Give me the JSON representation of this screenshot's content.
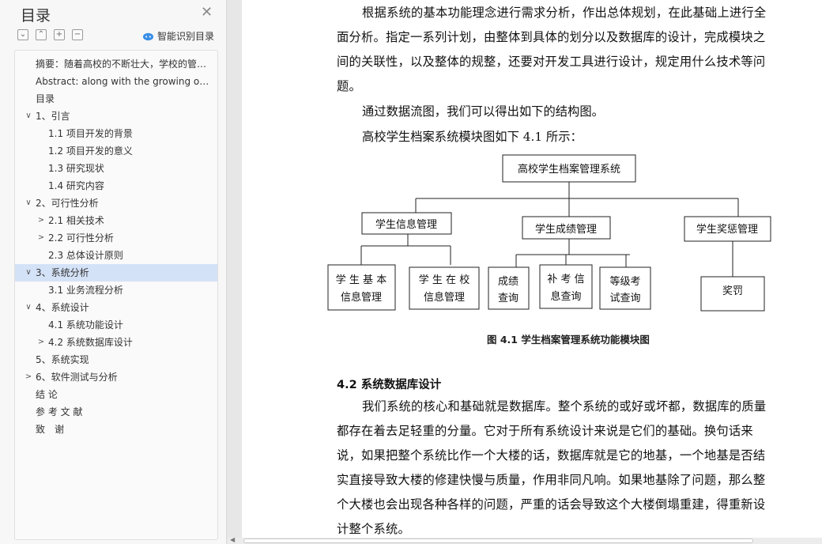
{
  "sidebar": {
    "title": "目录",
    "smart_toc_label": "智能识别目录",
    "toc": [
      {
        "label": "摘要：随着高校的不断壮大，学校的管理模式也在发生变化",
        "level": 1,
        "toggle": "none"
      },
      {
        "label": "Abstract: along with the growing of university",
        "level": 1,
        "toggle": "none"
      },
      {
        "label": "目录",
        "level": 1,
        "toggle": "none"
      },
      {
        "label": "1、引言",
        "level": 1,
        "toggle": "expanded"
      },
      {
        "label": "1.1 项目开发的背景",
        "level": 2,
        "toggle": "none"
      },
      {
        "label": "1.2 项目开发的意义",
        "level": 2,
        "toggle": "none"
      },
      {
        "label": "1.3 研究现状",
        "level": 2,
        "toggle": "none"
      },
      {
        "label": "1.4 研究内容",
        "level": 2,
        "toggle": "none"
      },
      {
        "label": "2、可行性分析",
        "level": 1,
        "toggle": "expanded"
      },
      {
        "label": "2.1 相关技术",
        "level": 2,
        "toggle": "collapsed"
      },
      {
        "label": "2.2 可行性分析",
        "level": 2,
        "toggle": "collapsed"
      },
      {
        "label": "2.3 总体设计原则",
        "level": 2,
        "toggle": "none"
      },
      {
        "label": "3、系统分析",
        "level": 1,
        "toggle": "expanded",
        "selected": true
      },
      {
        "label": "3.1 业务流程分析",
        "level": 2,
        "toggle": "none"
      },
      {
        "label": "4、系统设计",
        "level": 1,
        "toggle": "expanded"
      },
      {
        "label": "4.1 系统功能设计",
        "level": 2,
        "toggle": "none"
      },
      {
        "label": "4.2 系统数据库设计",
        "level": 2,
        "toggle": "collapsed"
      },
      {
        "label": "5、系统实现",
        "level": 1,
        "toggle": "none"
      },
      {
        "label": "6、软件测试与分析",
        "level": 1,
        "toggle": "collapsed"
      },
      {
        "label": "结 论",
        "level": 1,
        "toggle": "none"
      },
      {
        "label": "参 考 文 献",
        "level": 1,
        "toggle": "none"
      },
      {
        "label": "致　谢",
        "level": 1,
        "toggle": "none"
      }
    ]
  },
  "document": {
    "para1": "根据系统的基本功能理念进行需求分析，作出总体规划，在此基础上进行全面分析。指定一系列计划，由整体到具体的划分以及数据库的设计，完成模块之间的关联性，以及整体的规整，还要对开发工具进行设计，规定用什么技术等问题。",
    "para2": "通过数据流图，我们可以得出如下的结构图。",
    "para3": "高校学生档案系统模块图如下 4.1 所示：",
    "diagram": {
      "root": "高校学生档案管理系统",
      "groups": [
        {
          "label": "学生信息管理",
          "children": [
            [
              "学 生 基 本",
              "信息管理"
            ],
            [
              "学 生 在 校",
              "信息管理"
            ]
          ]
        },
        {
          "label": "学生成绩管理",
          "children": [
            [
              "成绩",
              "查询"
            ],
            [
              "补 考 信",
              "息查询"
            ],
            [
              "等级考",
              "试查询"
            ]
          ]
        },
        {
          "label": "学生奖惩管理",
          "children": [
            [
              "奖罚"
            ]
          ]
        }
      ]
    },
    "caption": "图 4.1  学生档案管理系统功能模块图",
    "heading": "4.2 系统数据库设计",
    "para4": "我们系统的核心和基础就是数据库。整个系统的或好或坏都，数据库的质量都存在着去足轻重的分量。它对于所有系统设计来说是它们的基础。换句话来说，如果把整个系统比作一个大楼的话，数据库就是它的地基，一个地基是否结实直接导致大楼的修建快慢与质量，作用非同凡响。如果地基除了问题，那么整个大楼也会出现各种各样的问题，严重的话会导致这个大楼倒塌重建，得重新设计整个系统。"
  }
}
